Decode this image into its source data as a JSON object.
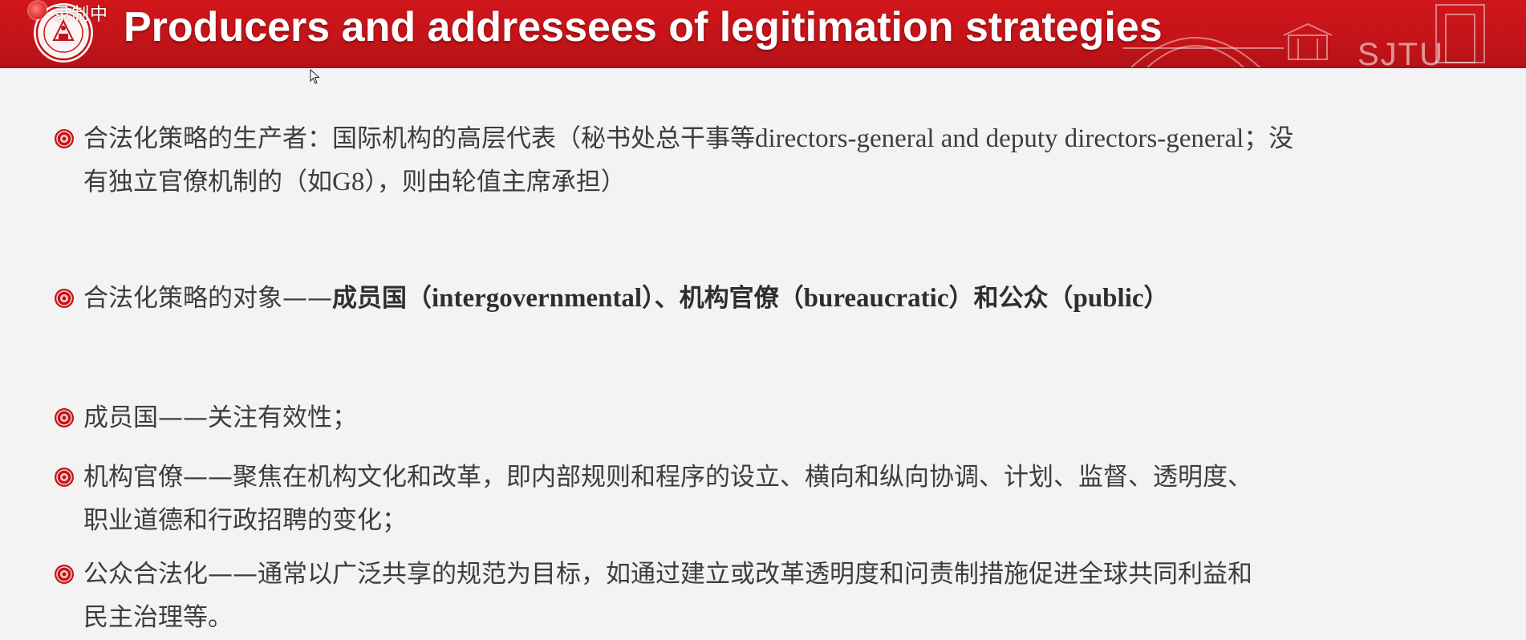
{
  "header": {
    "title": "Producers and addressees of legitimation strategies",
    "recording_label": "录制中",
    "watermark": "SJTU",
    "background_color": "#c41419"
  },
  "bullets": [
    {
      "id": "producers",
      "line1_a": "合法化策略的生产者：国际机构的高层代表（秘书处总干事等",
      "line1_b": "directors-general and deputy directors-general",
      "line1_c": "；没",
      "line2_a": "有独立官僚机制的（如",
      "line2_b": "G8",
      "line2_c": "），则由轮值主席承担）"
    },
    {
      "id": "addressees",
      "a": "合法化策略的对象——",
      "b": "成员国（",
      "c": "intergovernmental",
      "d": "）、机构官僚（",
      "e": "bureaucratic",
      "f": "）和公众（",
      "g": "public",
      "h": "）"
    },
    {
      "id": "member-states",
      "text": "成员国——关注有效性；"
    },
    {
      "id": "bureaucrats",
      "line1": "机构官僚——聚焦在机构文化和改革，即内部规则和程序的设立、横向和纵向协调、计划、监督、透明度、",
      "line2": "职业道德和行政招聘的变化；"
    },
    {
      "id": "public",
      "line1": "公众合法化——通常以广泛共享的规范为目标，如通过建立或改革透明度和问责制措施促进全球共同利益和",
      "line2": "民主治理等。"
    }
  ],
  "icons": {
    "bullet": "university-seal-bullet-icon",
    "recording": "recording-dot-icon",
    "logo": "sjtu-logo-icon",
    "cursor": "mouse-cursor-icon"
  }
}
